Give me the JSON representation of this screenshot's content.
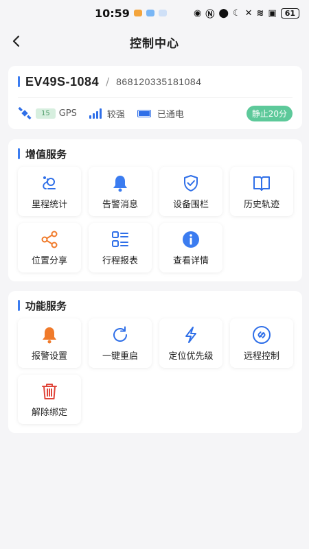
{
  "status_bar": {
    "time": "10:59",
    "battery": "61"
  },
  "nav": {
    "title": "控制中心"
  },
  "device": {
    "name": "EV49S-1084",
    "separator": "/",
    "imei": "868120335181084",
    "gps_count": "15",
    "gps_label": "GPS",
    "signal_label": "较强",
    "power_label": "已通电",
    "status": "静止20分"
  },
  "value_services": {
    "title": "增值服务",
    "items": [
      {
        "label": "里程统计",
        "icon": "mileage-icon"
      },
      {
        "label": "告警消息",
        "icon": "bell-icon"
      },
      {
        "label": "设备围栏",
        "icon": "shield-check-icon"
      },
      {
        "label": "历史轨迹",
        "icon": "book-icon"
      },
      {
        "label": "位置分享",
        "icon": "share-icon"
      },
      {
        "label": "行程报表",
        "icon": "list-report-icon"
      },
      {
        "label": "查看详情",
        "icon": "info-icon"
      }
    ]
  },
  "function_services": {
    "title": "功能服务",
    "items": [
      {
        "label": "报警设置",
        "icon": "alarm-bell-icon"
      },
      {
        "label": "一键重启",
        "icon": "restart-icon"
      },
      {
        "label": "定位优先级",
        "icon": "lightning-icon"
      },
      {
        "label": "远程控制",
        "icon": "link-icon"
      },
      {
        "label": "解除绑定",
        "icon": "trash-icon"
      }
    ]
  },
  "colors": {
    "accent": "#3b7cf0",
    "orange": "#f07a2a",
    "red": "#e0453a",
    "status_green": "#5dc99a"
  }
}
